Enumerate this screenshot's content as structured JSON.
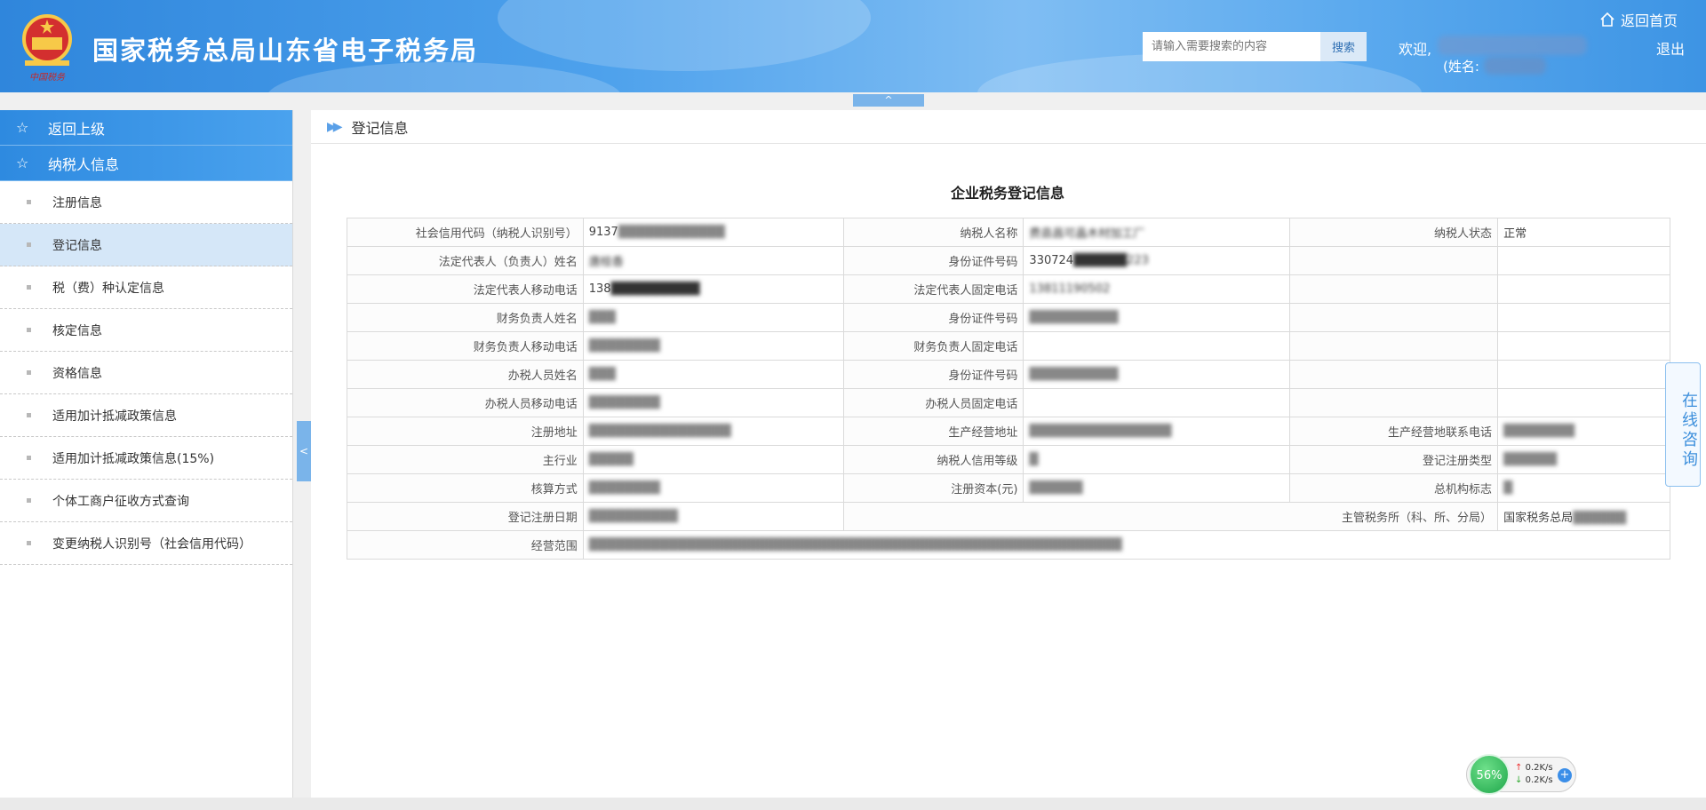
{
  "header": {
    "site_title": "国家税务总局山东省电子税务局",
    "search_placeholder": "请输入需要搜索的内容",
    "search_button": "搜索",
    "welcome": "欢迎,",
    "name_label": "(姓名:",
    "home_link": "返回首页",
    "logout": "退出",
    "collapse_top": "^"
  },
  "sidebar": {
    "back": "返回上级",
    "section": "纳税人信息",
    "items": [
      {
        "label": "注册信息"
      },
      {
        "label": "登记信息"
      },
      {
        "label": "税（费）种认定信息"
      },
      {
        "label": "核定信息"
      },
      {
        "label": "资格信息"
      },
      {
        "label": "适用加计抵减政策信息"
      },
      {
        "label": "适用加计抵减政策信息(15%)"
      },
      {
        "label": "个体工商户征收方式查询"
      },
      {
        "label": "变更纳税人识别号（社会信用代码）"
      }
    ],
    "toggle": "<"
  },
  "main": {
    "breadcrumb": "登记信息",
    "form_title": "企业税务登记信息",
    "rows": [
      {
        "l1": "社会信用代码（纳税人识别号）",
        "v1": "9137",
        "l2": "纳税人名称",
        "v2": "费县昌可晶木材加工厂",
        "l3": "纳税人状态",
        "v3": "正常"
      },
      {
        "l1": "法定代表人（负责人）姓名",
        "v1": "唐桂香",
        "l2": "身份证件号码",
        "v2": "330724",
        "l3": "",
        "v3": ""
      },
      {
        "l1": "法定代表人移动电话",
        "v1": "138",
        "l2": "法定代表人固定电话",
        "v2": "13811190502",
        "l3": "",
        "v3": ""
      },
      {
        "l1": "财务负责人姓名",
        "v1": "",
        "l2": "身份证件号码",
        "v2": "",
        "l3": "",
        "v3": ""
      },
      {
        "l1": "财务负责人移动电话",
        "v1": "",
        "l2": "财务负责人固定电话",
        "v2": "",
        "l3": "",
        "v3": ""
      },
      {
        "l1": "办税人员姓名",
        "v1": "",
        "l2": "身份证件号码",
        "v2": "",
        "l3": "",
        "v3": ""
      },
      {
        "l1": "办税人员移动电话",
        "v1": "",
        "l2": "办税人员固定电话",
        "v2": "",
        "l3": "",
        "v3": ""
      },
      {
        "l1": "注册地址",
        "v1": "",
        "l2": "生产经营地址",
        "v2": "",
        "l3": "生产经营地联系电话",
        "v3": ""
      },
      {
        "l1": "主行业",
        "v1": "",
        "l2": "纳税人信用等级",
        "v2": "",
        "l3": "登记注册类型",
        "v3": ""
      },
      {
        "l1": "核算方式",
        "v1": "",
        "l2": "注册资本(元)",
        "v2": "",
        "l3": "总机构标志",
        "v3": ""
      }
    ],
    "reg_date_label": "登记注册日期",
    "tax_office_label": "主管税务所（科、所、分局）",
    "tax_office_value": "国家税务总局",
    "scope_label": "经营范围"
  },
  "float": {
    "consult": "在线咨询",
    "percent": "56%",
    "up": "0.2K/s",
    "down": "0.2K/s",
    "plus": "+"
  },
  "colors": {
    "accent": "#2e8ae0",
    "active_row": "#d5e7f8"
  }
}
